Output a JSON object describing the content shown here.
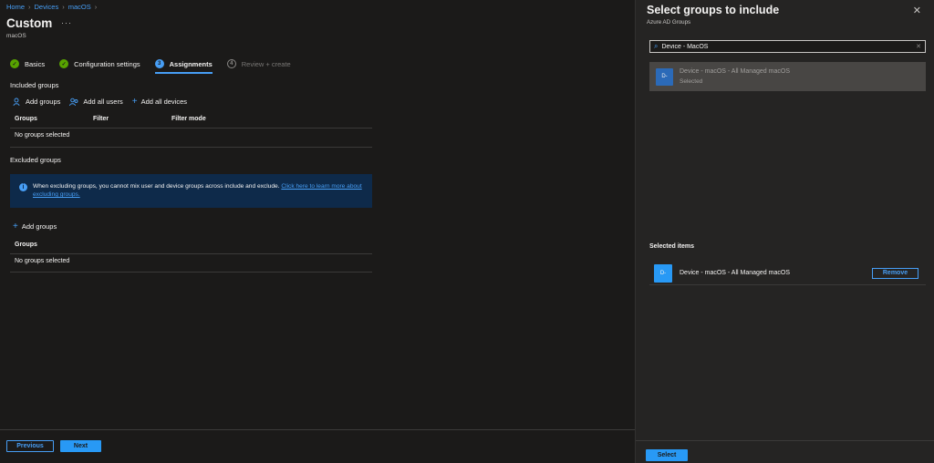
{
  "breadcrumb": [
    "Home",
    "Devices",
    "macOS"
  ],
  "page": {
    "title": "Custom",
    "more": "···",
    "subtitle": "macOS"
  },
  "steps": [
    {
      "label": "Basics",
      "state": "done",
      "marker": "✓"
    },
    {
      "label": "Configuration settings",
      "state": "done",
      "marker": "✓"
    },
    {
      "label": "Assignments",
      "state": "active",
      "marker": "3"
    },
    {
      "label": "Review + create",
      "state": "todo",
      "marker": "4"
    }
  ],
  "included": {
    "heading": "Included groups",
    "actions": [
      {
        "label": "Add groups",
        "icon": "add-groups-icon"
      },
      {
        "label": "Add all users",
        "icon": "add-users-icon"
      },
      {
        "label": "Add all devices",
        "icon": "plus-icon"
      }
    ],
    "columns": [
      "Groups",
      "Filter",
      "Filter mode"
    ],
    "empty": "No groups selected"
  },
  "excluded": {
    "heading": "Excluded groups",
    "info": "When excluding groups, you cannot mix user and device groups across include and exclude.",
    "info_link": "Click here to learn more about excluding groups.",
    "action": "Add groups",
    "column": "Groups",
    "empty": "No groups selected"
  },
  "footer": {
    "previous": "Previous",
    "next": "Next"
  },
  "panel": {
    "title": "Select groups to include",
    "subtitle": "Azure AD Groups",
    "search_value": "Device - MacOS",
    "result": {
      "avatar": "D-",
      "name": "Device - macOS - All Managed macOS",
      "status": "Selected"
    },
    "selected_heading": "Selected items",
    "selected": {
      "avatar": "D-",
      "name": "Device - macOS - All Managed macOS",
      "remove": "Remove"
    },
    "select_button": "Select"
  },
  "colors": {
    "accent": "#479ef5",
    "success": "#57a300",
    "background": "#1b1a19",
    "panel": "#252423"
  }
}
